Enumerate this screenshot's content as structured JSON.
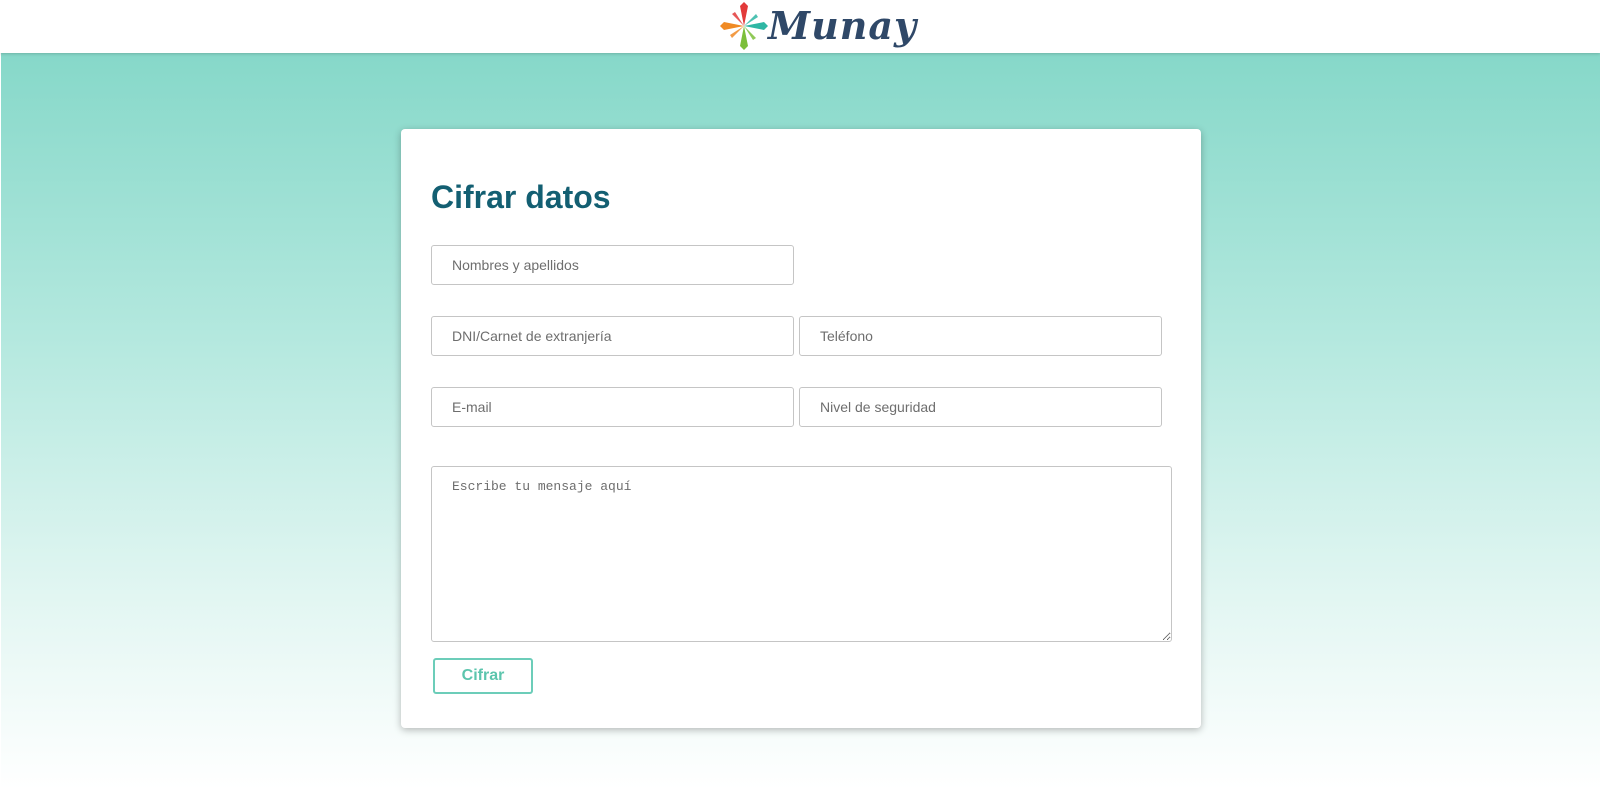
{
  "header": {
    "logo_text": "Munay",
    "logo_icon": "four-people-star-icon",
    "logo_colors": [
      "#e23a3a",
      "#2fb7a4",
      "#f08a24",
      "#7cbf3a"
    ]
  },
  "form": {
    "title": "Cifrar datos",
    "fields": {
      "name_placeholder": "Nombres y apellidos",
      "dni_placeholder": "DNI/Carnet de extranjería",
      "phone_placeholder": "Teléfono",
      "email_placeholder": "E-mail",
      "security_placeholder": "Nivel de seguridad",
      "message_placeholder": "Escribe tu mensaje aquí"
    },
    "submit_label": "Cifrar"
  },
  "colors": {
    "accent": "#5cc5ad",
    "title": "#135f72",
    "gradient_top": "#86d8c9"
  }
}
